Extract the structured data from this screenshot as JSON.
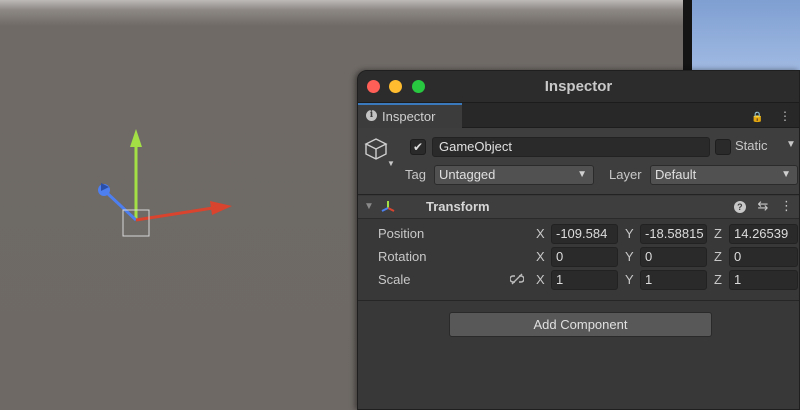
{
  "inspector": {
    "window_title": "Inspector",
    "tab_label": "Inspector",
    "tab_icon_glyph": "i",
    "tab_tools": {
      "lock": "🔒",
      "menu": "⋮"
    }
  },
  "gameobject": {
    "active": true,
    "name": "GameObject",
    "static_label": "Static",
    "static_checked": false,
    "tag_label": "Tag",
    "tag_value": "Untagged",
    "layer_label": "Layer",
    "layer_value": "Default"
  },
  "transform": {
    "title": "Transform",
    "rows": [
      {
        "label": "Position",
        "x": "-109.584",
        "y": "-18.58815",
        "z": "14.26539"
      },
      {
        "label": "Rotation",
        "x": "0",
        "y": "0",
        "z": "0"
      },
      {
        "label": "Scale",
        "x": "1",
        "y": "1",
        "z": "1"
      }
    ],
    "axis_labels": {
      "x": "X",
      "y": "Y",
      "z": "Z"
    }
  },
  "add_component_label": "Add Component",
  "colors": {
    "scene_bg": "#6f6a66",
    "panel_bg": "#383838",
    "accent_tab": "#3a79bb",
    "gizmo_x": "#d9442e",
    "gizmo_y": "#a3e046",
    "gizmo_z": "#4d7ff0"
  },
  "icons": {
    "gameobject": "cube-icon",
    "transform": "axes-icon",
    "scale_link": "link-broken-icon"
  }
}
